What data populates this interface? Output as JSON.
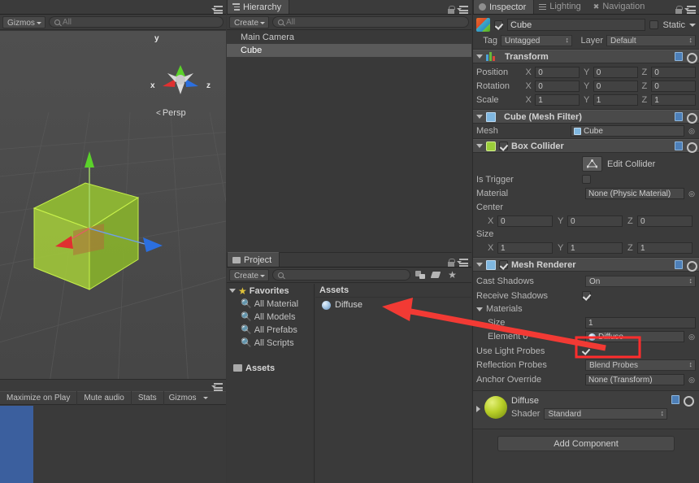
{
  "scene_view": {
    "gizmos_button": "Gizmos",
    "search_placeholder": "All",
    "persp_label": "Persp",
    "axis_x": "x",
    "axis_y": "y",
    "axis_z": "z"
  },
  "game_view": {
    "maximize": "Maximize on Play",
    "mute": "Mute audio",
    "stats": "Stats",
    "gizmos": "Gizmos"
  },
  "hierarchy": {
    "tab": "Hierarchy",
    "create_button": "Create",
    "search_placeholder": "All",
    "items": [
      {
        "label": "Main Camera",
        "selected": false
      },
      {
        "label": "Cube",
        "selected": true
      }
    ]
  },
  "project": {
    "tab": "Project",
    "create_button": "Create",
    "search_placeholder": "",
    "favorites_label": "Favorites",
    "favorites": [
      "All Material",
      "All Models",
      "All Prefabs",
      "All Scripts"
    ],
    "assets_tree_label": "Assets",
    "assets_header": "Assets",
    "assets": [
      {
        "label": "Diffuse",
        "icon": "material-sphere-icon"
      }
    ]
  },
  "inspector": {
    "tabs": [
      {
        "label": "Inspector",
        "active": true,
        "icon": "inspector-icon"
      },
      {
        "label": "Lighting",
        "active": false,
        "icon": "lighting-icon"
      },
      {
        "label": "Navigation",
        "active": false,
        "icon": "navigation-icon"
      }
    ],
    "object_name": "Cube",
    "object_enabled": true,
    "static_label": "Static",
    "static_checked": false,
    "tag_label": "Tag",
    "tag_value": "Untagged",
    "layer_label": "Layer",
    "layer_value": "Default",
    "components": [
      {
        "name": "Transform",
        "icon": "transform-icon",
        "rows": [
          {
            "label": "Position",
            "x": "0",
            "y": "0",
            "z": "0"
          },
          {
            "label": "Rotation",
            "x": "0",
            "y": "0",
            "z": "0"
          },
          {
            "label": "Scale",
            "x": "1",
            "y": "1",
            "z": "1"
          }
        ]
      },
      {
        "name": "Cube (Mesh Filter)",
        "icon": "mesh-filter-icon",
        "mesh_label": "Mesh",
        "mesh_value": "Cube"
      },
      {
        "name": "Box Collider",
        "icon": "box-collider-icon",
        "enabled": true,
        "edit_collider_label": "Edit Collider",
        "is_trigger_label": "Is Trigger",
        "is_trigger_checked": false,
        "material_label": "Material",
        "material_value": "None (Physic Material)",
        "center_label": "Center",
        "center": {
          "x": "0",
          "y": "0",
          "z": "0"
        },
        "size_label": "Size",
        "size": {
          "x": "1",
          "y": "1",
          "z": "1"
        }
      },
      {
        "name": "Mesh Renderer",
        "icon": "mesh-renderer-icon",
        "enabled": true,
        "cast_shadows_label": "Cast Shadows",
        "cast_shadows_value": "On",
        "receive_shadows_label": "Receive Shadows",
        "receive_shadows_checked": true,
        "materials_label": "Materials",
        "size_label": "Size",
        "size_value": "1",
        "element0_label": "Element 0",
        "element0_value": "Diffuse",
        "use_light_probes_label": "Use Light Probes",
        "use_light_probes_checked": true,
        "reflection_probes_label": "Reflection Probes",
        "reflection_probes_value": "Blend Probes",
        "anchor_override_label": "Anchor Override",
        "anchor_override_value": "None (Transform)"
      }
    ],
    "material_preview": {
      "name": "Diffuse",
      "shader_label": "Shader",
      "shader_value": "Standard"
    },
    "add_component_label": "Add Component"
  },
  "annotation": {
    "highlight_color": "#ff2d2d",
    "arrow_color": "#f23a34",
    "target_label": "Element 0 material slot"
  },
  "colors": {
    "background": "#383838",
    "panel": "#393939",
    "selection": "#5a5a5a",
    "cube_green": "#9cc13b",
    "axis_x": "#e03030",
    "axis_y": "#5bd22a",
    "axis_z": "#2b6fe0"
  }
}
